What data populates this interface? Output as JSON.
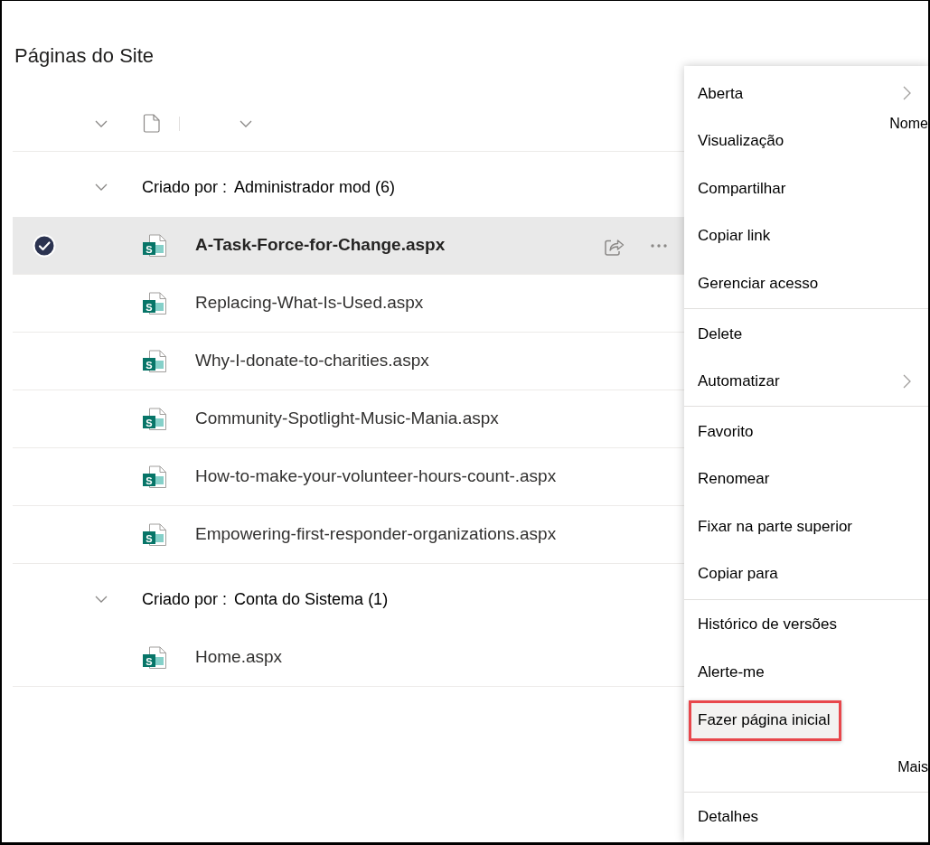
{
  "page": {
    "title": "Páginas do Site"
  },
  "list_header": {
    "column_label": "Nome"
  },
  "groups": [
    {
      "label": "Criado por :",
      "value": "Administrador mod (6)",
      "expanded": true,
      "rows": [
        {
          "name": "A-Task-Force-for-Change.aspx",
          "icon_letter": "S",
          "selected": true
        },
        {
          "name": "Replacing-What-Is-Used.aspx",
          "icon_letter": "S",
          "selected": false
        },
        {
          "name": "Why-I-donate-to-charities.aspx",
          "icon_letter": "S",
          "selected": false
        },
        {
          "name": "Community-Spotlight-Music-Mania.aspx",
          "icon_letter": "S",
          "selected": false
        },
        {
          "name": "How-to-make-your-volunteer-hours-count-.aspx",
          "icon_letter": "S",
          "selected": false
        },
        {
          "name": "Empowering-first-responder-organizations.aspx",
          "icon_letter": "S",
          "selected": false
        }
      ]
    },
    {
      "label": "Criado por :",
      "value": "Conta do Sistema (1)",
      "expanded": true,
      "rows": [
        {
          "name": "Home.aspx",
          "icon_letter": "S",
          "selected": false
        }
      ]
    }
  ],
  "context_menu": {
    "sections": [
      {
        "items": [
          {
            "label": "Aberta",
            "kind": "action",
            "submenu": true,
            "highlighted": false
          },
          {
            "label": "Visualização",
            "kind": "action",
            "submenu": false,
            "highlighted": false
          },
          {
            "label": "Compartilhar",
            "kind": "action",
            "submenu": false,
            "highlighted": false
          },
          {
            "label": "Copiar link",
            "kind": "action",
            "submenu": false,
            "highlighted": false
          },
          {
            "label": "Gerenciar acesso",
            "kind": "action",
            "submenu": false,
            "highlighted": false
          }
        ]
      },
      {
        "items": [
          {
            "label": "Delete",
            "kind": "action",
            "submenu": false,
            "highlighted": false
          },
          {
            "label": "Automatizar",
            "kind": "action",
            "submenu": true,
            "highlighted": false
          }
        ]
      },
      {
        "items": [
          {
            "label": "Favorito",
            "kind": "action",
            "submenu": false,
            "highlighted": false
          },
          {
            "label": "Renomear",
            "kind": "action",
            "submenu": false,
            "highlighted": false
          },
          {
            "label": "Fixar na parte superior",
            "kind": "action",
            "submenu": false,
            "highlighted": false
          },
          {
            "label": "Copiar para",
            "kind": "action",
            "submenu": false,
            "highlighted": false
          }
        ]
      },
      {
        "items": [
          {
            "label": "Histórico de versões",
            "kind": "action",
            "submenu": false,
            "highlighted": false
          },
          {
            "label": "Alerte-me",
            "kind": "action",
            "submenu": false,
            "highlighted": false
          },
          {
            "label": "Fazer página inicial",
            "kind": "action",
            "submenu": false,
            "highlighted": true
          },
          {
            "label": "Mais",
            "kind": "more",
            "submenu": false,
            "highlighted": false
          }
        ]
      },
      {
        "items": [
          {
            "label": "Detalhes",
            "kind": "action",
            "submenu": false,
            "highlighted": false
          }
        ]
      }
    ]
  }
}
